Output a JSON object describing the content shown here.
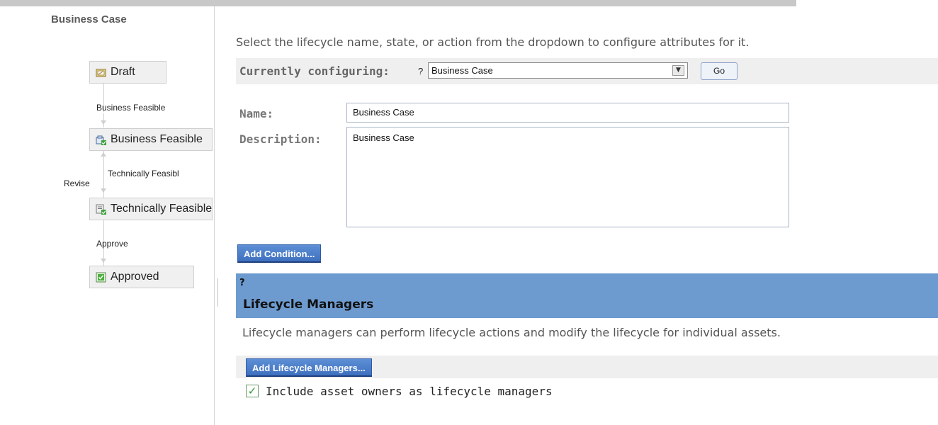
{
  "sidebar": {
    "title": "Business Case",
    "states": [
      {
        "label": "Draft",
        "icon": "draft-state-icon"
      },
      {
        "label": "Business Feasible",
        "icon": "business-feasible-state-icon"
      },
      {
        "label": "Technically Feasible",
        "icon": "technically-feasible-state-icon"
      },
      {
        "label": "Approved",
        "icon": "approved-state-icon"
      }
    ],
    "transitions": {
      "business_feasible": "Business Feasible",
      "technically_feasible": "Technically Feasibl",
      "revise": "Revise",
      "approve": "Approve"
    }
  },
  "main": {
    "intro": "Select the lifecycle name, state, or action from the dropdown to configure attributes for it.",
    "configuring": {
      "label": "Currently configuring:",
      "help": "?",
      "selected": "Business Case",
      "go_label": "Go"
    },
    "form": {
      "name_label": "Name:",
      "name_value": "Business Case",
      "description_label": "Description:",
      "description_value": "Business Case"
    },
    "add_condition_label": "Add Condition...",
    "lifecycle_managers": {
      "help": "?",
      "title": "Lifecycle Managers",
      "description": "Lifecycle managers can perform lifecycle actions and modify the lifecycle for individual assets.",
      "add_button_label": "Add Lifecycle Managers...",
      "include_owners_label": "Include asset owners as lifecycle managers",
      "include_owners_checked": true
    }
  },
  "colors": {
    "accent_blue": "#6d9bd0",
    "button_blue": "#3e70bf",
    "check_green": "#2e9a2e"
  }
}
